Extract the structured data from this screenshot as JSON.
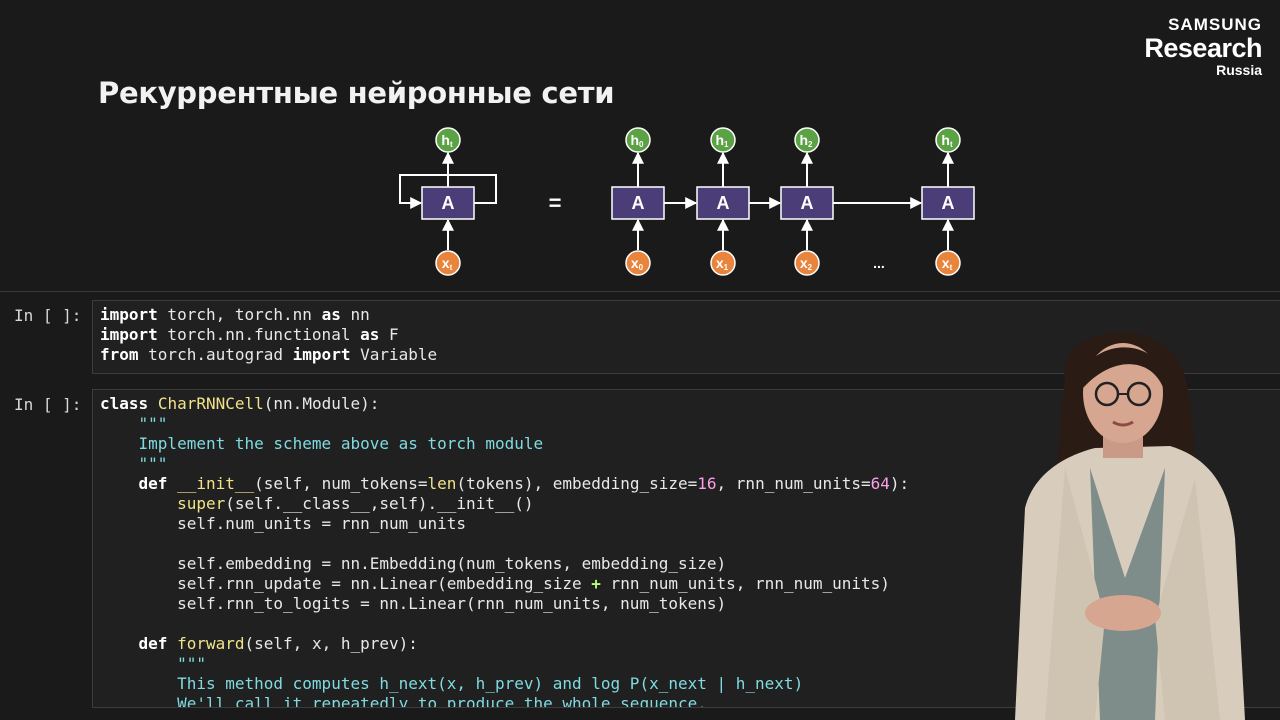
{
  "brand": {
    "line1": "SAMSUNG",
    "line2": "Research",
    "line3": "Russia"
  },
  "slide": {
    "title": "Рекуррентные нейронные сети",
    "diagram": {
      "cell_label": "A",
      "equals": "=",
      "ellipsis": "...",
      "rolled": {
        "h": "ht",
        "x": "xt"
      },
      "unrolled": [
        {
          "h": "h0",
          "x": "x0"
        },
        {
          "h": "h1",
          "x": "x1"
        },
        {
          "h": "h2",
          "x": "x2"
        },
        {
          "h": "ht",
          "x": "xt"
        }
      ]
    }
  },
  "notebook": {
    "cells": [
      {
        "prompt": "In [ ]:",
        "lines": [
          [
            [
              "kw",
              "import"
            ],
            [
              "tx",
              " torch, torch.nn "
            ],
            [
              "kw",
              "as"
            ],
            [
              "tx",
              " nn"
            ]
          ],
          [
            [
              "kw",
              "import"
            ],
            [
              "tx",
              " torch.nn.functional "
            ],
            [
              "kw",
              "as"
            ],
            [
              "tx",
              " F"
            ]
          ],
          [
            [
              "kw",
              "from"
            ],
            [
              "tx",
              " torch.autograd "
            ],
            [
              "kw",
              "import"
            ],
            [
              "tx",
              " Variable"
            ]
          ]
        ]
      },
      {
        "prompt": "In [ ]:",
        "lines": [
          [
            [
              "kw",
              "class"
            ],
            [
              "tx",
              " "
            ],
            [
              "fn",
              "CharRNNCell"
            ],
            [
              "tx",
              "(nn.Module):"
            ]
          ],
          [
            [
              "doc",
              "    \"\"\""
            ]
          ],
          [
            [
              "doc",
              "    Implement the scheme above as torch module"
            ]
          ],
          [
            [
              "doc",
              "    \"\"\""
            ]
          ],
          [
            [
              "tx",
              "    "
            ],
            [
              "kw",
              "def"
            ],
            [
              "tx",
              " "
            ],
            [
              "fn",
              "__init__"
            ],
            [
              "tx",
              "(self, num_tokens="
            ],
            [
              "fn",
              "len"
            ],
            [
              "tx",
              "(tokens), embedding_size="
            ],
            [
              "num",
              "16"
            ],
            [
              "tx",
              ", rnn_num_units="
            ],
            [
              "num",
              "64"
            ],
            [
              "tx",
              "):"
            ]
          ],
          [
            [
              "tx",
              "        "
            ],
            [
              "fn",
              "super"
            ],
            [
              "tx",
              "(self.__class__,self).__init__()"
            ]
          ],
          [
            [
              "tx",
              "        self.num_units = rnn_num_units"
            ]
          ],
          [
            [
              "tx",
              ""
            ]
          ],
          [
            [
              "tx",
              "        self.embedding = nn.Embedding(num_tokens, embedding_size)"
            ]
          ],
          [
            [
              "tx",
              "        self.rnn_update = nn.Linear(embedding_size "
            ],
            [
              "op",
              "+"
            ],
            [
              "tx",
              " rnn_num_units, rnn_num_units)"
            ]
          ],
          [
            [
              "tx",
              "        self.rnn_to_logits = nn.Linear(rnn_num_units, num_tokens)"
            ]
          ],
          [
            [
              "tx",
              ""
            ]
          ],
          [
            [
              "tx",
              "    "
            ],
            [
              "kw",
              "def"
            ],
            [
              "tx",
              " "
            ],
            [
              "fn",
              "forward"
            ],
            [
              "tx",
              "(self, x, h_prev):"
            ]
          ],
          [
            [
              "doc",
              "        \"\"\""
            ]
          ],
          [
            [
              "doc",
              "        This method computes h_next(x, h_prev) and log P(x_next | h_next)"
            ]
          ],
          [
            [
              "doc",
              "        We'll call it repeatedly to produce the whole sequence."
            ]
          ]
        ]
      }
    ]
  },
  "colors": {
    "h_node": "#5aa244",
    "x_node": "#e9843c",
    "cell_fill": "#4b3e78",
    "arrow": "#ffffff"
  }
}
